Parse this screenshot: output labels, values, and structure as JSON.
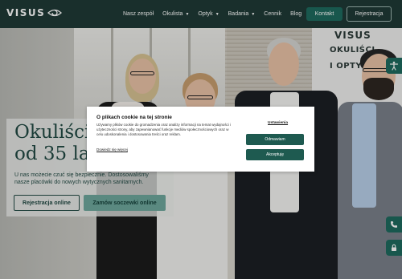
{
  "header": {
    "logo_text": "VISUS",
    "nav": [
      {
        "label": "Nasz zespół",
        "dropdown": false
      },
      {
        "label": "Okulista",
        "dropdown": true
      },
      {
        "label": "Optyk",
        "dropdown": true
      },
      {
        "label": "Badania",
        "dropdown": true
      },
      {
        "label": "Cennik",
        "dropdown": false
      },
      {
        "label": "Blog",
        "dropdown": false
      }
    ],
    "kontakt_label": "Kontakt",
    "rejestracja_label": "Rejestracja"
  },
  "wall_sign": {
    "brand": "VISUS",
    "line1": "OKULIŚCI",
    "line2": "I OPTYCY"
  },
  "hero": {
    "title_line1": "Okuliści",
    "title_line2": "od 35 lat",
    "subtitle": "U nas możecie czuć się bezpiecznie. Dostosowaliśmy nasze placówki do nowych wytycznych sanitarnych.",
    "register_button": "Rejestracja online",
    "lenses_button": "Zamów soczewki online"
  },
  "side_buttons": [
    {
      "icon": "accessibility-icon"
    },
    {
      "icon": "phone-icon"
    },
    {
      "icon": "lock-icon"
    }
  ],
  "cookie": {
    "title": "O plikach cookie na tej stronie",
    "text": "Używamy plików cookie do gromadzenia oraz analizy informacji na temat wydajności i użyteczności strony, aby zapewnianować funkcje mediów społecznościowych oraz w celu udoskonalenia i dostosowania treści oraz reklam.",
    "link": "Dowiedz się więcej",
    "settings": "Ustawienia",
    "decline": "Odmawiam",
    "accept": "Akceptuję"
  },
  "colors": {
    "header_bg": "#1f3a36",
    "accent": "#1e6b5e",
    "hero_text": "#224a44",
    "secondary_button": "#6ea89d"
  }
}
